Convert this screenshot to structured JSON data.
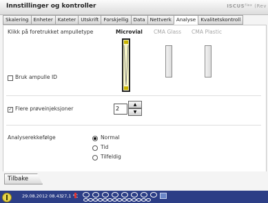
{
  "window": {
    "title": "Innstillinger og kontroller",
    "brand": "ISCUS",
    "brand_sup": "flex",
    "brand_tail": "(Rev"
  },
  "tabs": [
    {
      "label": "Skalering",
      "active": false
    },
    {
      "label": "Enheter",
      "active": false
    },
    {
      "label": "Kateter",
      "active": false
    },
    {
      "label": "Utskrift",
      "active": false
    },
    {
      "label": "Forskjellig",
      "active": false
    },
    {
      "label": "Data",
      "active": false
    },
    {
      "label": "Nettverk",
      "active": false
    },
    {
      "label": "Analyse",
      "active": true
    },
    {
      "label": "Kvalitetskontroll",
      "active": false
    }
  ],
  "analyse": {
    "vial_type_label": "Klikk på foretrukket ampulletype",
    "vials": [
      {
        "label": "Microvial",
        "selected": true
      },
      {
        "label": "CMA Glass",
        "selected": false
      },
      {
        "label": "CMA Plastic",
        "selected": false
      }
    ],
    "use_vial_id": {
      "label": "Bruk ampulle ID",
      "checked": false
    },
    "multi_injection": {
      "label": "Flere prøveinjeksjoner",
      "checked": true,
      "value": "2"
    },
    "order": {
      "label": "Analyserekkefølge",
      "options": [
        {
          "label": "Normal",
          "selected": true
        },
        {
          "label": "Tid",
          "selected": false
        },
        {
          "label": "Tilfeldig",
          "selected": false
        }
      ]
    }
  },
  "footer": {
    "back_label": "Tilbake"
  },
  "statusbar": {
    "datetime": "29.08.2012 08.43",
    "temperature": "27,1 °C"
  },
  "colors": {
    "statusbar_bg": "#2c3e86",
    "selected_vial": "#f7f6c8",
    "disabled_text": "#a6a6a6"
  }
}
